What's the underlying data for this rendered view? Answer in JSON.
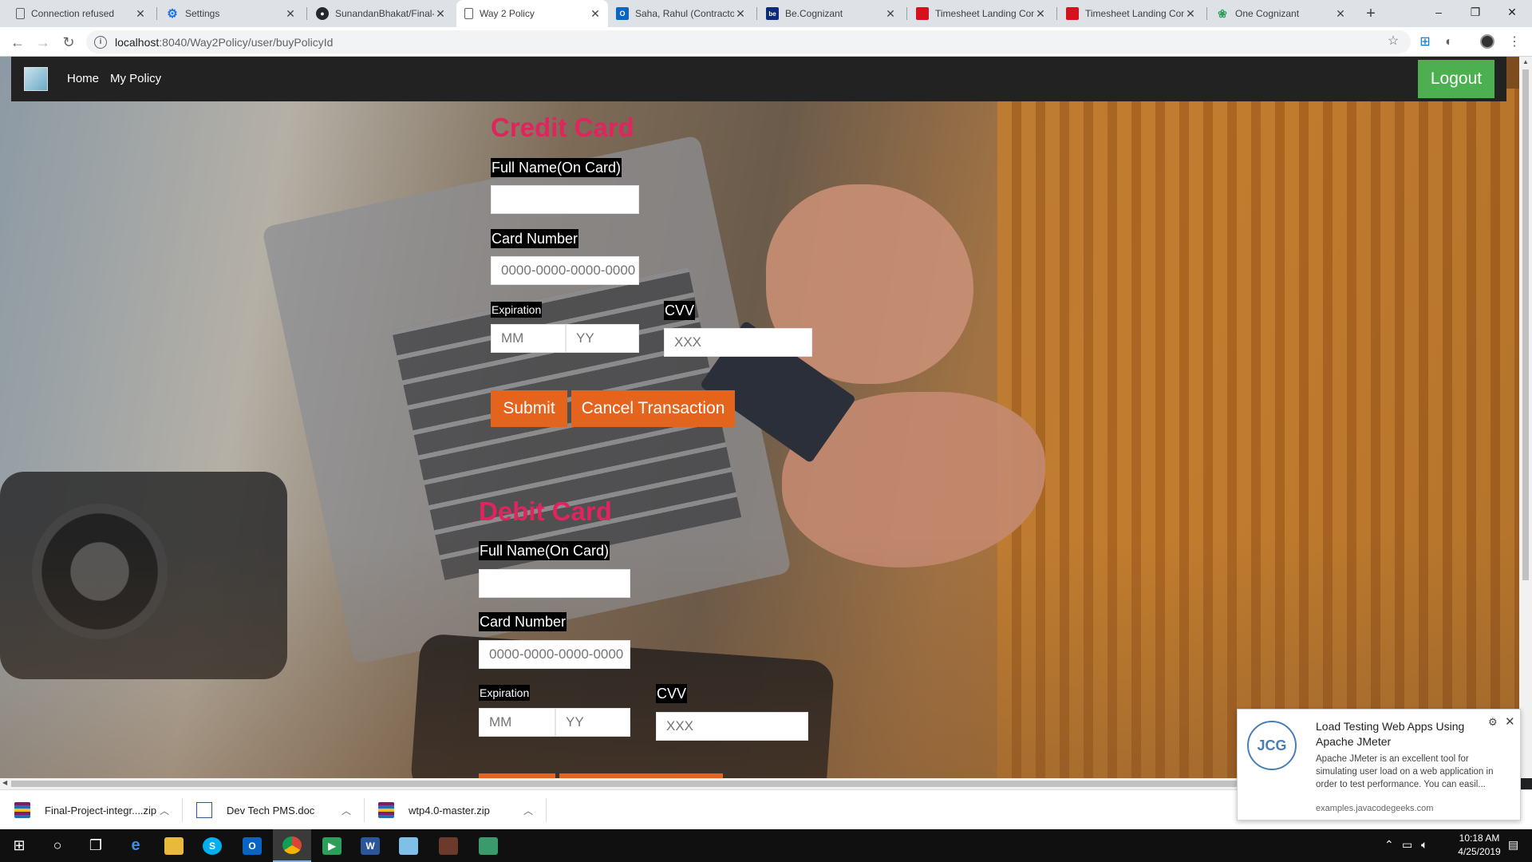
{
  "browser": {
    "tabs": [
      {
        "title": "Connection refused",
        "icon": "page-icon",
        "active": false
      },
      {
        "title": "Settings",
        "icon": "gear-icon",
        "active": false
      },
      {
        "title": "SunandanBhakat/Final-",
        "icon": "github-icon",
        "active": false
      },
      {
        "title": "Way 2 Policy",
        "icon": "page-icon",
        "active": true
      },
      {
        "title": "Saha, Rahul (Contractor",
        "icon": "outlook-icon",
        "active": false
      },
      {
        "title": "Be.Cognizant",
        "icon": "becognizant-icon",
        "active": false
      },
      {
        "title": "Timesheet Landing Con",
        "icon": "timesheet-icon",
        "active": false
      },
      {
        "title": "Timesheet Landing Con",
        "icon": "timesheet-icon",
        "active": false
      },
      {
        "title": "One Cognizant",
        "icon": "onecognizant-icon",
        "active": false
      }
    ],
    "new_tab": "+",
    "window_controls": {
      "minimize": "–",
      "maximize": "❐",
      "close": "✕"
    },
    "url": "localhost:8040/Way2Policy/user/buyPolicyId",
    "url_host": "localhost",
    "url_rest": ":8040/Way2Policy/user/buyPolicyId"
  },
  "app_nav": {
    "links": [
      "Home",
      "My Policy"
    ],
    "logout": "Logout"
  },
  "credit_card": {
    "title": "Credit Card",
    "name_label": "Full Name(On Card)",
    "name_value": "",
    "number_label": "Card Number",
    "number_placeholder": "0000-0000-0000-0000",
    "expiration_label": "Expiration",
    "month_placeholder": "MM",
    "year_placeholder": "YY",
    "cvv_label": "CVV",
    "cvv_placeholder": "XXX",
    "submit": "Submit",
    "cancel": "Cancel Transaction"
  },
  "debit_card": {
    "title": "Debit Card",
    "name_label": "Full Name(On Card)",
    "name_value": "",
    "number_label": "Card Number",
    "number_placeholder": "0000-0000-0000-0000",
    "expiration_label": "Expiration",
    "month_placeholder": "MM",
    "year_placeholder": "YY",
    "cvv_label": "CVV",
    "cvv_placeholder": "XXX"
  },
  "downloads": [
    {
      "name": "Final-Project-integr....zip"
    },
    {
      "name": "Dev Tech PMS.doc"
    },
    {
      "name": "wtp4.0-master.zip"
    }
  ],
  "notification": {
    "logo_text": "JCG",
    "title": "Load Testing Web Apps Using Apache JMeter",
    "body": "Apache JMeter is an excellent tool for simulating user load on a web application in order to test performance. You can easil...",
    "source": "examples.javacodegeeks.com"
  },
  "taskbar": {
    "time": "10:18 AM",
    "date": "4/25/2019"
  },
  "colors": {
    "section_title": "#e0245e",
    "button": "#e4641e",
    "logout": "#4caf50",
    "navbar": "#222222"
  }
}
